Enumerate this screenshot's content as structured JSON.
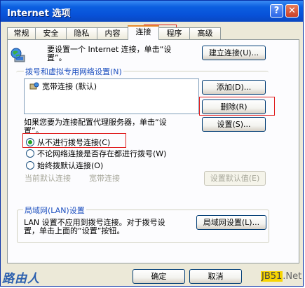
{
  "window": {
    "title": "Internet 选项"
  },
  "titlebar": {
    "help_icon": "question-mark-icon",
    "close_icon": "close-x-icon",
    "help_glyph": "?",
    "close_glyph": "✕"
  },
  "tabs": [
    {
      "label": "常规"
    },
    {
      "label": "安全"
    },
    {
      "label": "隐私"
    },
    {
      "label": "内容"
    },
    {
      "label": "连接",
      "active": true
    },
    {
      "label": "程序"
    },
    {
      "label": "高级"
    }
  ],
  "setup": {
    "text_line1": "要设置一个 Internet 连接，单击“设",
    "text_line2": "置”。",
    "button": "建立连接(U)..."
  },
  "dialup": {
    "group_label": "拨号和虚拟专用网络设置(N)",
    "connections": [
      "宽带连接 (默认)"
    ],
    "add_button": "添加(D)...",
    "remove_button": "删除(R)",
    "settings_button": "设置(S)...",
    "proxy_text_line1": "如果您要为连接配置代理服务器，单击“设",
    "proxy_text_line2": "置”。"
  },
  "dial_options": [
    {
      "label": "从不进行拨号连接(C)",
      "checked": true
    },
    {
      "label": "不论网络连接是否存在都进行拨号(W)",
      "checked": false
    },
    {
      "label": "始终拨默认连接(O)",
      "checked": false
    }
  ],
  "default_conn": {
    "label": "当前默认连接",
    "value": "宽带连接",
    "button": "设置默认值(E)"
  },
  "lan": {
    "group_label": "局域网(LAN)设置",
    "text_line1": "LAN 设置不应用到拨号连接。对于拨号设",
    "text_line2": "置，单击上面的“设置”按钮。",
    "button": "局域网设置(L)..."
  },
  "footer": {
    "ok_button": "确定",
    "cancel_button": "取消"
  },
  "watermark": {
    "left_text": "路由人",
    "right_highlight": "JB51",
    "right_suffix": ".Net"
  },
  "colors": {
    "titlebar": "#0851d8",
    "highlight_box": "#e02020",
    "group_label": "#1c4fbf"
  }
}
